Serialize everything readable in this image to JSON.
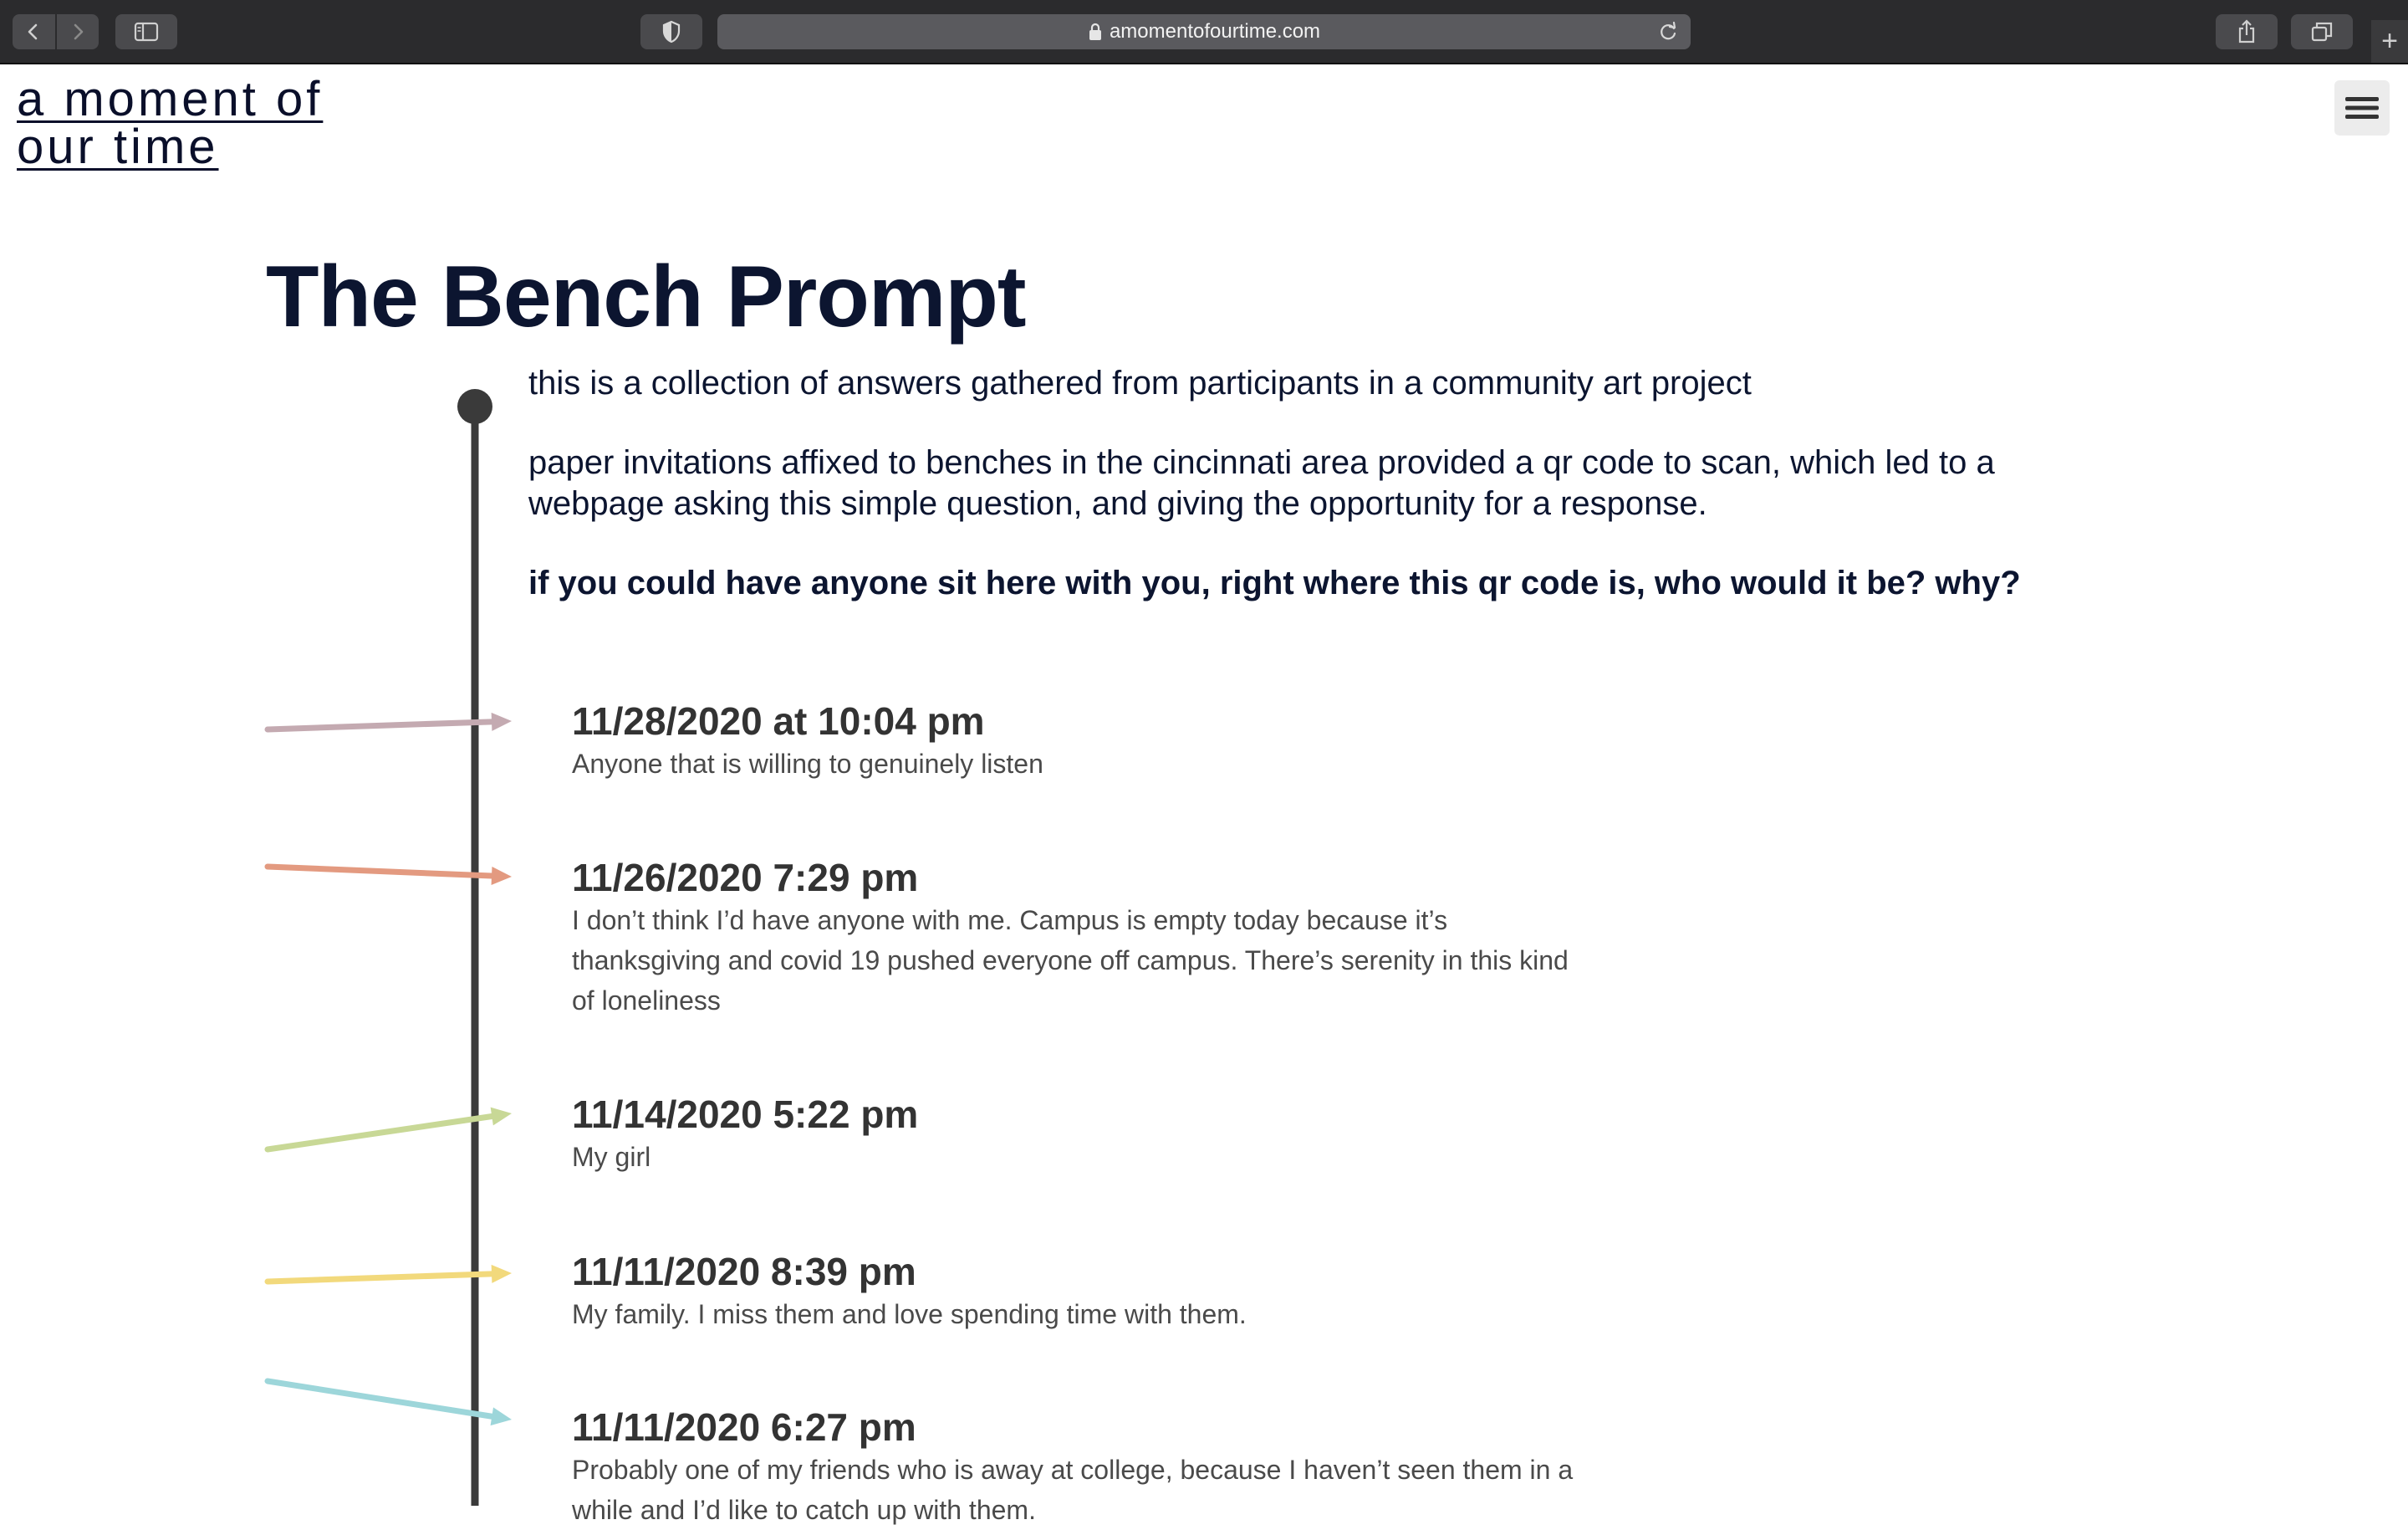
{
  "browser": {
    "url": "amomentofourtime.com"
  },
  "site": {
    "logo": "a moment of our time"
  },
  "page": {
    "title": "The Bench Prompt",
    "intro": [
      "this is a collection of answers gathered from participants in a community art project",
      "paper invitations affixed to benches in the cincinnati area provided a qr code to scan, which led to a webpage asking this simple question, and giving the opportunity for a response."
    ],
    "question": "if you could have anyone sit here with you, right where this qr code is, who would it be? why?"
  },
  "entries": [
    {
      "date": "11/28/2020 at 10:04 pm",
      "text": "Anyone that is willing to genuinely listen",
      "arrow_color": "#c4aab1"
    },
    {
      "date": "11/26/2020 7:29 pm",
      "text": "I don’t think I’d have anyone with me. Campus is empty today because it’s thanksgiving and covid 19 pushed everyone off campus. There’s serenity in this kind of loneliness",
      "arrow_color": "#e39a80"
    },
    {
      "date": "11/14/2020 5:22 pm",
      "text": "My girl",
      "arrow_color": "#c8d896"
    },
    {
      "date": "11/11/2020 8:39 pm",
      "text": "My family. I miss them and love spending time with them.",
      "arrow_color": "#f2d97c"
    },
    {
      "date": "11/11/2020 6:27 pm",
      "text": "Probably one of my friends who is away at college, because I haven’t seen them in a while and I’d like to catch up with them.",
      "arrow_color": "#9dd6da"
    }
  ]
}
